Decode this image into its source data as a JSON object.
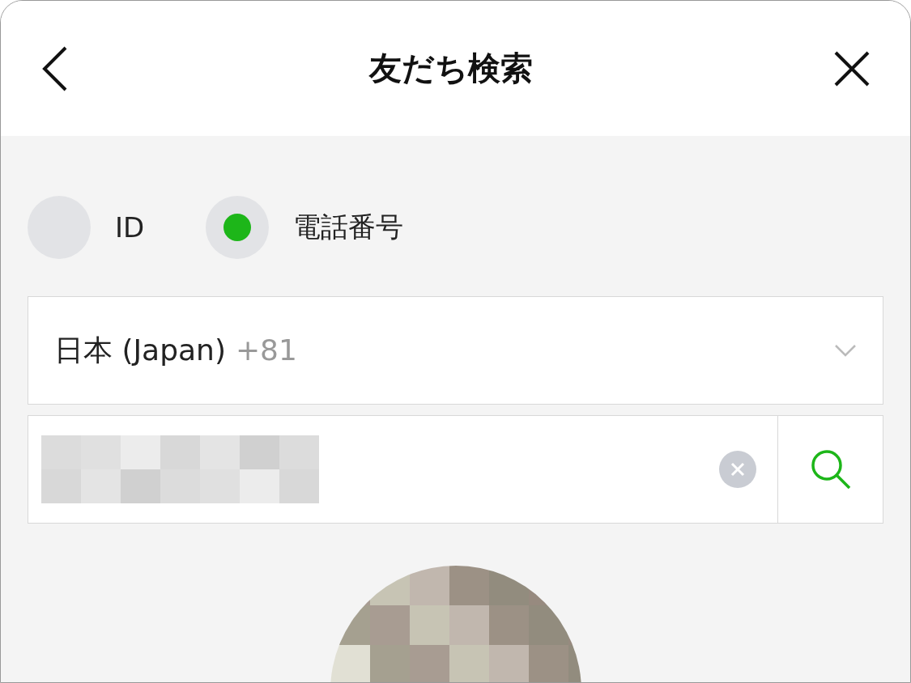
{
  "header": {
    "title": "友だち検索"
  },
  "search_type": [
    {
      "label": "ID",
      "selected": false
    },
    {
      "label": "電話番号",
      "selected": true
    }
  ],
  "country": {
    "name": "日本 (Japan)",
    "code": "+81"
  }
}
